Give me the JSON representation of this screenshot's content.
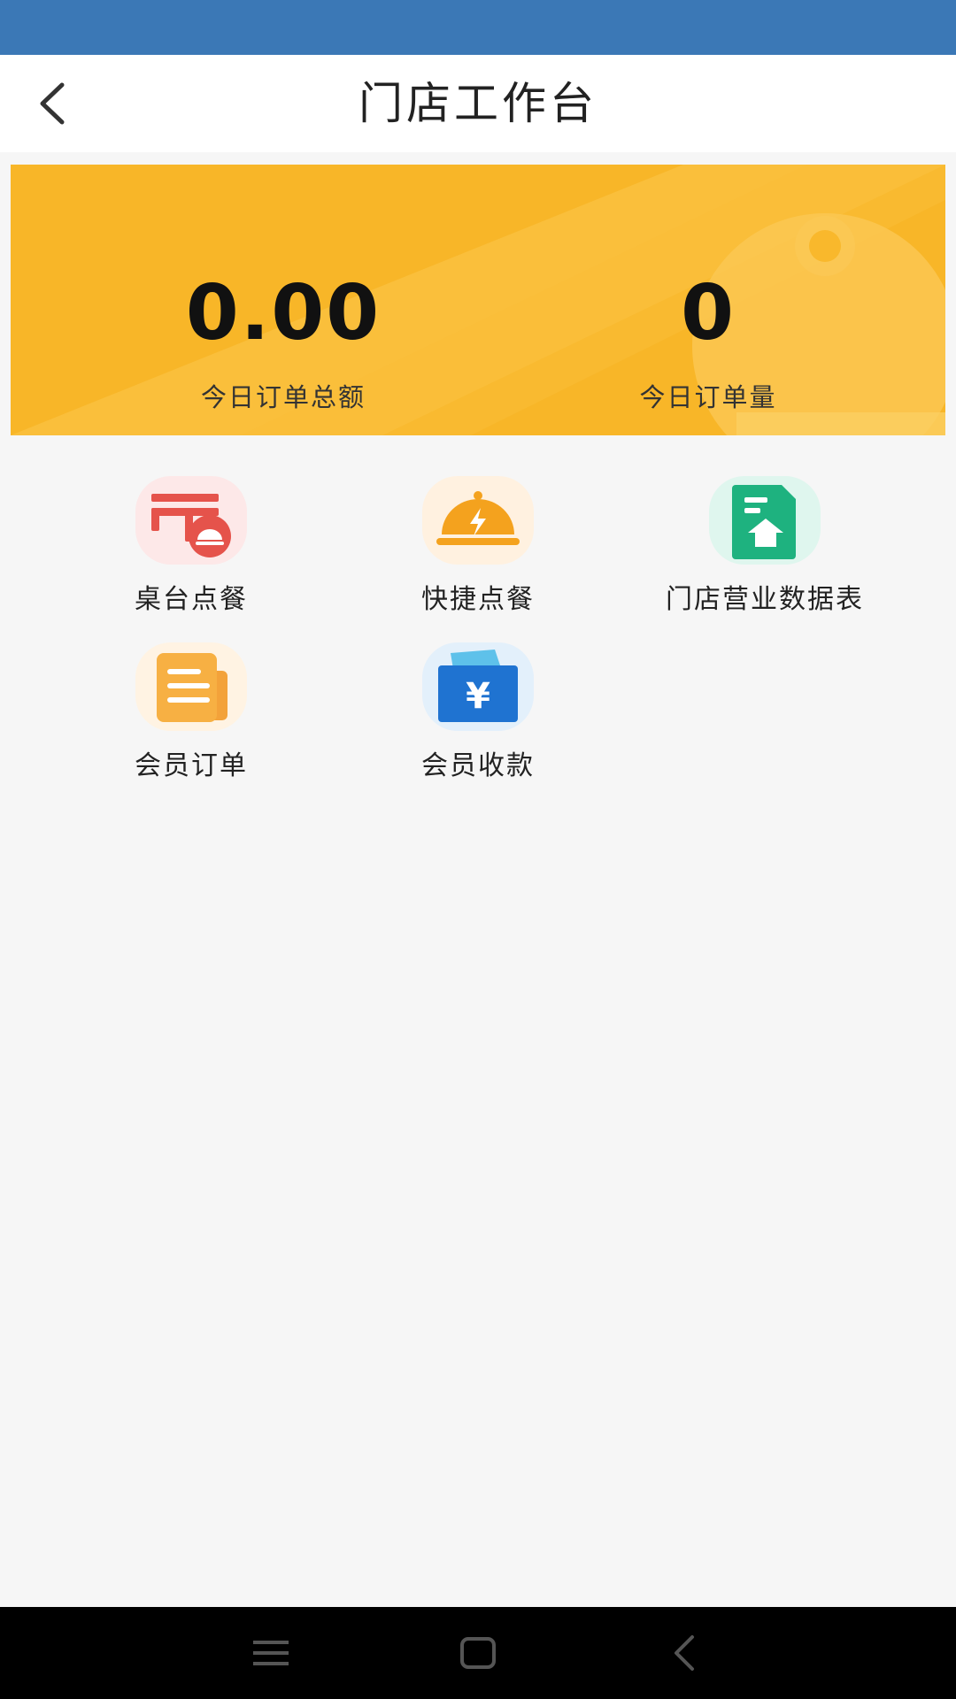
{
  "header": {
    "title": "门店工作台",
    "back_icon": "chevron-left-icon"
  },
  "stats": {
    "total_amount_value": "0.00",
    "total_amount_label": "今日订单总额",
    "order_count_value": "0",
    "order_count_label": "今日订单量"
  },
  "menu": {
    "items": [
      {
        "label": "桌台点餐",
        "icon": "table-order-icon"
      },
      {
        "label": "快捷点餐",
        "icon": "quick-order-icon"
      },
      {
        "label": "门店营业数据表",
        "icon": "store-report-icon"
      },
      {
        "label": "会员订单",
        "icon": "member-order-icon"
      },
      {
        "label": "会员收款",
        "icon": "member-payment-icon"
      }
    ]
  },
  "nav": {
    "menu_icon": "menu-icon",
    "home_icon": "home-square-icon",
    "back_icon": "back-triangle-icon"
  },
  "colors": {
    "status_bar": "#3b78b6",
    "stats_card": "#f8b628",
    "background": "#f6f6f6"
  }
}
